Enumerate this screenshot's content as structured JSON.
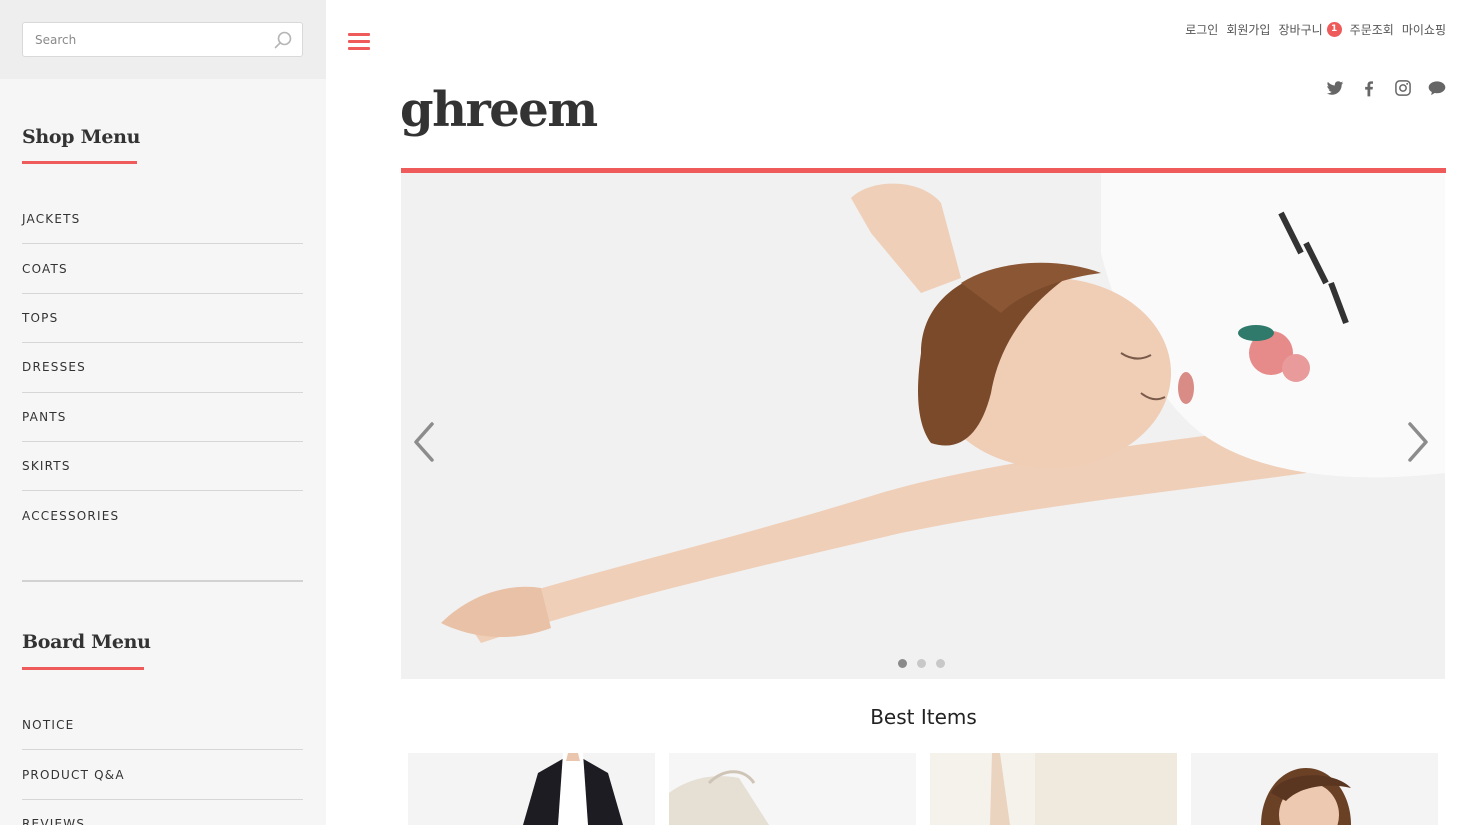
{
  "search": {
    "placeholder": "Search"
  },
  "shop_menu": {
    "title": "Shop Menu",
    "items": [
      "JACKETS",
      "COATS",
      "TOPS",
      "DRESSES",
      "PANTS",
      "SKIRTS",
      "ACCESSORIES"
    ]
  },
  "board_menu": {
    "title": "Board Menu",
    "items": [
      "NOTICE",
      "PRODUCT Q&A",
      "REVIEWS"
    ]
  },
  "header": {
    "logo": "ghreem",
    "links": {
      "login": "로그인",
      "join": "회원가입",
      "cart": "장바구니",
      "cart_count": "1",
      "order": "주문조회",
      "mypage": "마이쇼핑"
    },
    "social_icons": [
      "twitter-icon",
      "facebook-icon",
      "instagram-icon",
      "chat-icon"
    ]
  },
  "slider": {
    "active_index": 0,
    "slide_count": 3
  },
  "best_items": {
    "title": "Best Items"
  },
  "colors": {
    "accent": "#ef5b5b",
    "sidebar_bg": "#f6f6f7",
    "text": "#333333"
  }
}
